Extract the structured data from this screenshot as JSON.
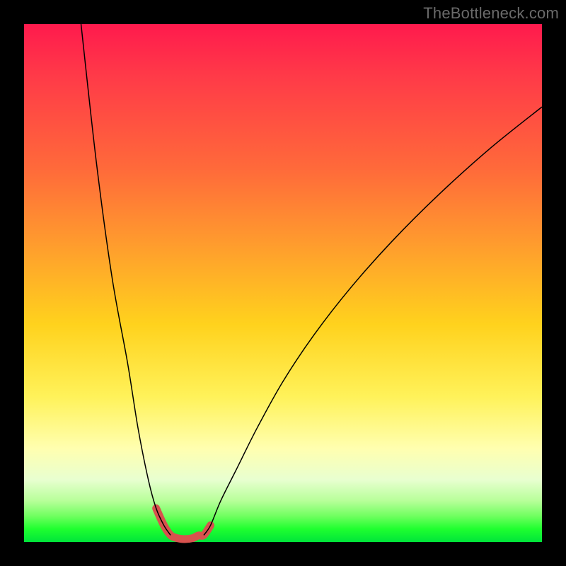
{
  "watermark": "TheBottleneck.com",
  "chart_data": {
    "type": "line",
    "title": "",
    "xlabel": "",
    "ylabel": "",
    "xlim": [
      0,
      100
    ],
    "ylim": [
      0,
      100
    ],
    "grid": false,
    "series": [
      {
        "name": "bottleneck-curve-left",
        "stroke": "#000000",
        "width": 1.5,
        "x": [
          11,
          14,
          17,
          20,
          22,
          24,
          25.5,
          27,
          28.3
        ],
        "values": [
          100,
          73,
          51,
          34.5,
          22,
          12,
          6.5,
          3.2,
          1.3
        ]
      },
      {
        "name": "bottleneck-curve-right",
        "stroke": "#000000",
        "width": 1.5,
        "x": [
          34.7,
          36,
          38,
          41,
          45,
          50,
          56,
          63,
          71,
          80,
          90,
          100
        ],
        "values": [
          1.3,
          3.2,
          8,
          14,
          22,
          31,
          40,
          49,
          58,
          67,
          76,
          84
        ]
      },
      {
        "name": "bottleneck-valley-highlight",
        "stroke": "#d8524e",
        "width": 11,
        "cap": "round",
        "x": [
          25.5,
          27,
          28.3,
          29.5,
          31.0,
          32.5,
          33.7,
          34.7,
          36
        ],
        "values": [
          6.5,
          3.2,
          1.3,
          0.75,
          0.55,
          0.72,
          1.25,
          1.3,
          3.2
        ]
      }
    ]
  }
}
